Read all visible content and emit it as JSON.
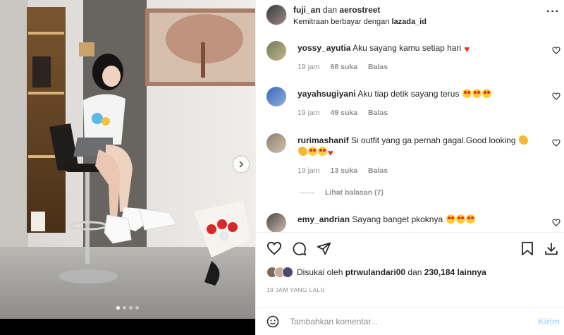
{
  "post": {
    "author": "fuji_an",
    "connector": "dan",
    "coauthor": "aerostreet",
    "partnership_prefix": "Kemitraan berbayar dengan",
    "partner": "lazada_id",
    "more_icon": "more-horizontal-icon"
  },
  "media": {
    "next_icon": "chevron-right-icon",
    "carousel_dots": 4,
    "active_dot": 0
  },
  "comments": [
    {
      "user": "yossy_ayutia",
      "text": "Aku sayang kamu setiap hari",
      "emojis": [
        "heart"
      ],
      "time": "19 jam",
      "likes": "68 suka",
      "reply": "Balas"
    },
    {
      "user": "yayahsugiyani",
      "text": "Aku tiap detik sayang terus",
      "emojis": [
        "eyes",
        "eyes",
        "eyes"
      ],
      "time": "19 jam",
      "likes": "49 suka",
      "reply": "Balas"
    },
    {
      "user": "rurimashanif",
      "text": "Si outfit yang ga pernah gagal.Good looking",
      "emojis": [
        "clap",
        "clap",
        "eyes",
        "eyes",
        "heart"
      ],
      "time": "19 jam",
      "likes": "13 suka",
      "reply": "Balas"
    },
    {
      "user": "emy_andrian",
      "text": "Sayang banget pkoknya",
      "emojis": [
        "eyes",
        "eyes",
        "eyes"
      ]
    }
  ],
  "view_replies": "Lihat balasan (7)",
  "liked_by": {
    "prefix": "Disukai oleh",
    "user": "ptrwulandari00",
    "and": "dan",
    "others": "230,184 lainnya"
  },
  "timestamp": "19 JAM YANG LALU",
  "add_comment": {
    "placeholder": "Tambahkan komentar...",
    "post_label": "Kirim"
  },
  "colors": {
    "accent": "#0095f6",
    "heart": "#ed2b2b",
    "muted": "#8e8e8e"
  }
}
